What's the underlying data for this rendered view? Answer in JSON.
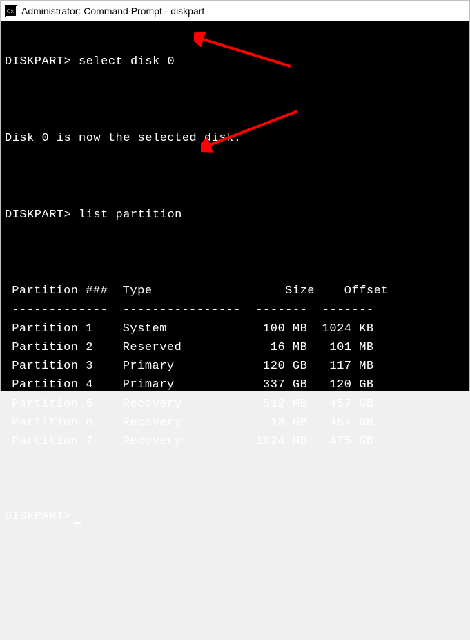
{
  "window": {
    "title": "Administrator: Command Prompt - diskpart"
  },
  "terminal": {
    "prompt": "DISKPART>",
    "cmd1": "select disk 0",
    "response1": "Disk 0 is now the selected disk.",
    "cmd2": "list partition",
    "table": {
      "headers": {
        "col1": "Partition ###",
        "col2": "Type",
        "col3": "Size",
        "col4": "Offset"
      },
      "divider": {
        "col1": "-------------",
        "col2": "----------------",
        "col3": "-------",
        "col4": "-------"
      },
      "rows": [
        {
          "name": "Partition 1",
          "type": "System",
          "size": "100 MB",
          "offset": "1024 KB"
        },
        {
          "name": "Partition 2",
          "type": "Reserved",
          "size": "16 MB",
          "offset": "101 MB"
        },
        {
          "name": "Partition 3",
          "type": "Primary",
          "size": "120 GB",
          "offset": "117 MB"
        },
        {
          "name": "Partition 4",
          "type": "Primary",
          "size": "337 GB",
          "offset": "120 GB"
        },
        {
          "name": "Partition 5",
          "type": "Recovery",
          "size": "512 MB",
          "offset": "457 GB"
        },
        {
          "name": "Partition 6",
          "type": "Recovery",
          "size": "18 GB",
          "offset": "457 GB"
        },
        {
          "name": "Partition 7",
          "type": "Recovery",
          "size": "1024 MB",
          "offset": "475 GB"
        }
      ]
    }
  },
  "annotations": {
    "arrow_color": "#ff0000"
  }
}
